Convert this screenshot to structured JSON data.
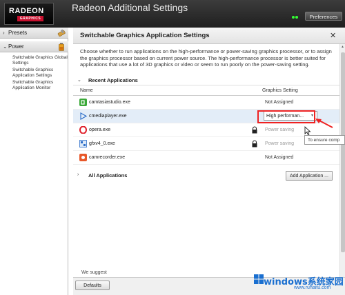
{
  "header": {
    "logo_line1": "RADEON",
    "logo_line2": "GRAPHICS",
    "app_title": "Radeon Additional Settings",
    "preferences_label": "Preferences"
  },
  "sidebar": {
    "presets_label": "Presets",
    "power_label": "Power",
    "sub_items": [
      "Switchable Graphics Global Settings",
      "Switchable Graphics Application Settings",
      "Switchable Graphics Application Monitor"
    ]
  },
  "main": {
    "title": "Switchable Graphics Application Settings",
    "close_glyph": "✕",
    "description": "Choose whether to run applications on the high-performance or power-saving graphics processor, or to assign the graphics processor based on current power source. The high-performance processor is better suited for applications that use a lot of 3D graphics or video or seem to run poorly on the power-saving setting.",
    "recent_section_label": "Recent Applications",
    "col_name": "Name",
    "col_setting": "Graphics Setting",
    "apps": [
      {
        "name": "camtasiastudio.exe",
        "setting": "Not Assigned",
        "icon": "camtasia-icon",
        "locked": false
      },
      {
        "name": "cmediaplayer.exe",
        "setting": "High performan...",
        "icon": "play-icon",
        "locked": false
      },
      {
        "name": "opera.exe",
        "setting": "Power saving",
        "icon": "opera-icon",
        "locked": true
      },
      {
        "name": "gfxv4_0.exe",
        "setting": "Power saving",
        "icon": "gfx-icon",
        "locked": true
      },
      {
        "name": "camrecorder.exe",
        "setting": "Not Assigned",
        "icon": "recorder-icon",
        "locked": false
      }
    ],
    "all_section_label": "All Applications",
    "add_button_label": "Add Application ...",
    "tooltip": "To ensure comp",
    "suggest_text": "We suggest",
    "defaults_label": "Defaults"
  },
  "watermark": {
    "line1": "windows系统家园",
    "line2": "www.ruhaitu.com"
  },
  "colors": {
    "header_bg": "#2b2b2b",
    "radeon_red": "#c8102e",
    "selection": "#e3edf8",
    "highlight_red": "#e22222",
    "watermark_blue": "#1a6fd0"
  }
}
